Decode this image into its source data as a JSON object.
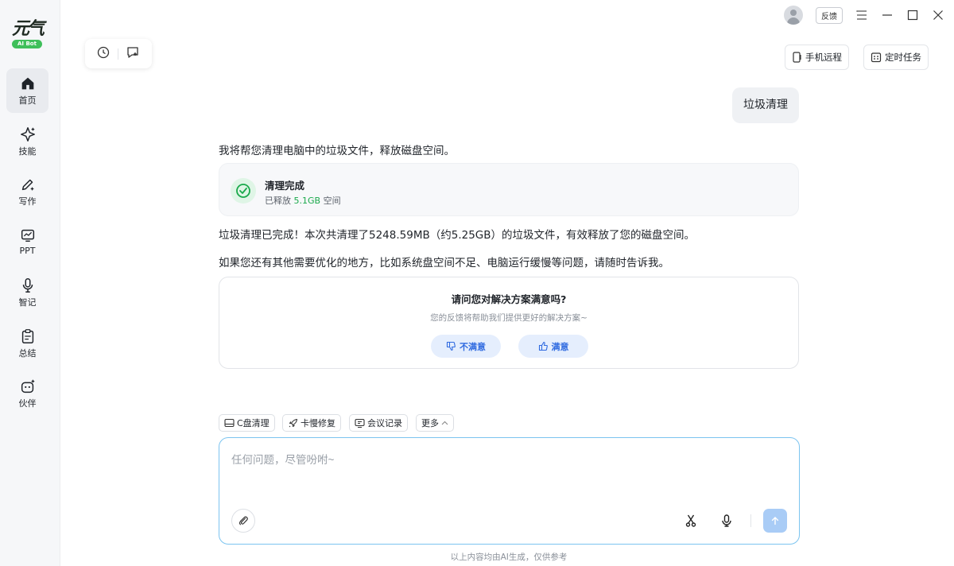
{
  "logo": {
    "text": "元气",
    "badge": "AI Bot"
  },
  "sidebar": {
    "items": [
      {
        "label": "首页",
        "icon": "home-icon",
        "active": true
      },
      {
        "label": "技能",
        "icon": "sparkle-icon"
      },
      {
        "label": "写作",
        "icon": "pen-icon"
      },
      {
        "label": "PPT",
        "icon": "presentation-icon"
      },
      {
        "label": "智记",
        "icon": "microphone-icon"
      },
      {
        "label": "总结",
        "icon": "clipboard-icon"
      },
      {
        "label": "伙伴",
        "icon": "bot-icon"
      }
    ]
  },
  "topbar": {
    "feedback_label": "反馈"
  },
  "header": {
    "mobile_remote_label": "手机远程",
    "scheduled_task_label": "定时任务"
  },
  "chat": {
    "user_message": "垃圾清理",
    "intro": "我将帮您清理电脑中的垃圾文件，释放磁盘空间。",
    "done_card": {
      "title": "清理完成",
      "released_prefix": "已释放",
      "released_value": "5.1GB",
      "released_suffix": "空间"
    },
    "result": "垃圾清理已完成！本次共清理了5248.59MB（约5.25GB）的垃圾文件，有效释放了您的磁盘空间。",
    "followup": "如果您还有其他需要优化的地方，比如系统盘空间不足、电脑运行缓慢等问题，请随时告诉我。",
    "survey": {
      "title": "请问您对解决方案满意吗?",
      "subtitle": "您的反馈将帮助我们提供更好的解决方案~",
      "dislike_label": "不满意",
      "like_label": "满意"
    }
  },
  "quick_actions": [
    {
      "label": "C盘清理",
      "icon": "disk-icon"
    },
    {
      "label": "卡慢修复",
      "icon": "rocket-icon"
    },
    {
      "label": "会议记录",
      "icon": "meeting-icon"
    },
    {
      "label": "更多",
      "icon": "chevron-up-icon"
    }
  ],
  "input": {
    "placeholder": "任何问题，尽管吩咐~",
    "value": ""
  },
  "footer": {
    "note": "以上内容均由AI生成，仅供参考"
  },
  "colors": {
    "accent": "#2f6ae0",
    "success": "#1aa94b",
    "input_border": "#7cc4f0",
    "send_button": "#a9ccf6"
  }
}
